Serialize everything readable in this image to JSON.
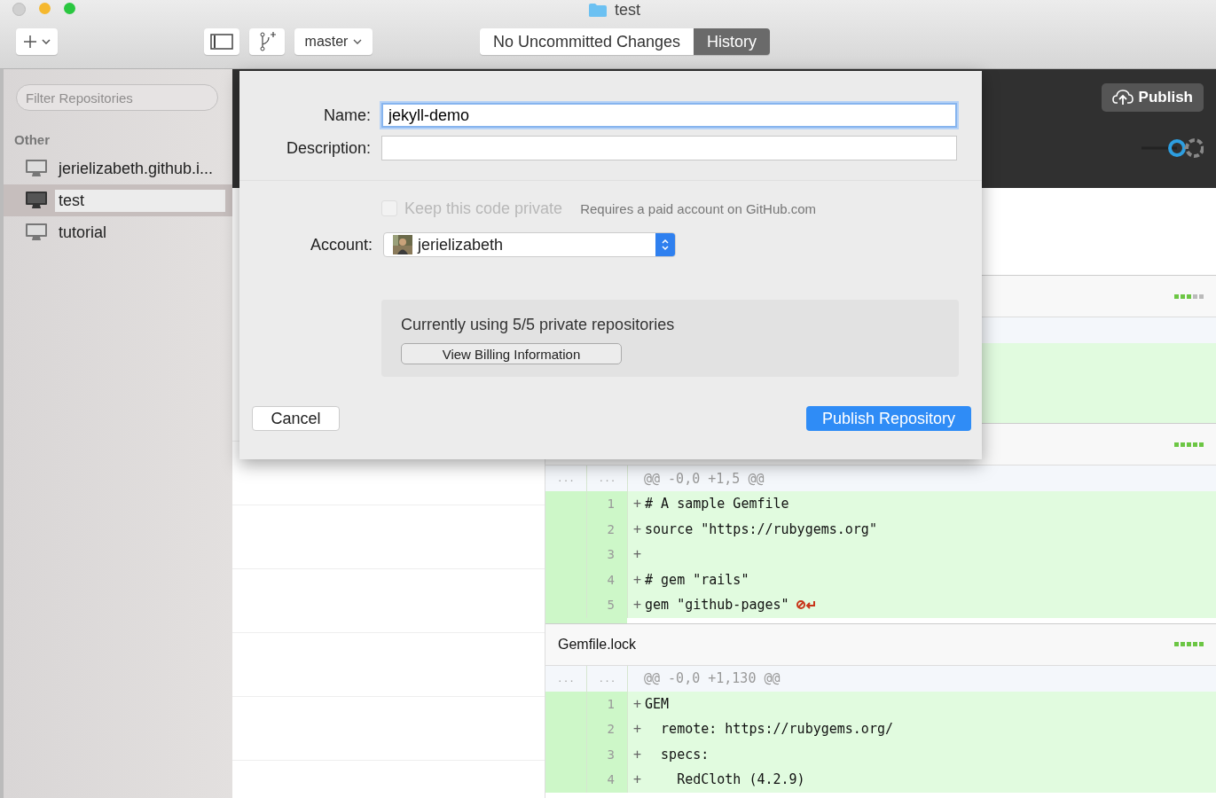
{
  "window": {
    "title": "test"
  },
  "toolbar": {
    "branch": "master",
    "tabs": [
      {
        "label": "No Uncommitted Changes",
        "selected": false
      },
      {
        "label": "History",
        "selected": true
      }
    ]
  },
  "sidebar": {
    "filter_placeholder": "Filter Repositories",
    "section": "Other",
    "items": [
      {
        "label": "jerielizabeth.github.i...",
        "selected": false
      },
      {
        "label": "test",
        "selected": true
      },
      {
        "label": "tutorial",
        "selected": false
      }
    ]
  },
  "header": {
    "publish": "Publish"
  },
  "files": [
    {
      "stars": 3
    },
    {
      "stars": 5,
      "gutter_old": "...",
      "gutter_new": "...",
      "hunk": "@@ -0,0 +1,5 @@",
      "lines": [
        {
          "number": "1",
          "sign": "+",
          "text": "# A sample Gemfile",
          "no_newline": false
        },
        {
          "number": "2",
          "sign": "+",
          "text": "source \"https://rubygems.org\"",
          "no_newline": false
        },
        {
          "number": "3",
          "sign": "+",
          "no_newline": false
        },
        {
          "number": "4",
          "sign": "+",
          "text": "# gem \"rails\"",
          "no_newline": false
        },
        {
          "number": "5",
          "sign": "+",
          "text": "gem \"github-pages\"",
          "no_newline": true
        }
      ]
    },
    {
      "name": "Gemfile.lock",
      "stars": 5,
      "gutter_old": "...",
      "gutter_new": "...",
      "hunk": "@@ -0,0 +1,130 @@",
      "lines": [
        {
          "number": "1",
          "sign": "+",
          "text": "GEM",
          "no_newline": false
        },
        {
          "number": "2",
          "sign": "+",
          "text": "  remote: https://rubygems.org/",
          "no_newline": false
        },
        {
          "number": "3",
          "sign": "+",
          "text": "  specs:",
          "no_newline": false
        },
        {
          "number": "4",
          "sign": "+",
          "text": "    RedCloth (4.2.9)",
          "no_newline": false
        }
      ]
    }
  ],
  "dialog": {
    "name_label": "Name:",
    "name_value": "jekyll-demo",
    "description_label": "Description:",
    "private_label": "Keep this code private",
    "private_checked": false,
    "private_disabled": true,
    "private_note": "Requires a paid account on GitHub.com",
    "account_label": "Account:",
    "account": "jerielizabeth",
    "usage": "Currently using 5/5 private repositories",
    "billing_button": "View Billing Information",
    "cancel": "Cancel",
    "publish": "Publish Repository"
  }
}
